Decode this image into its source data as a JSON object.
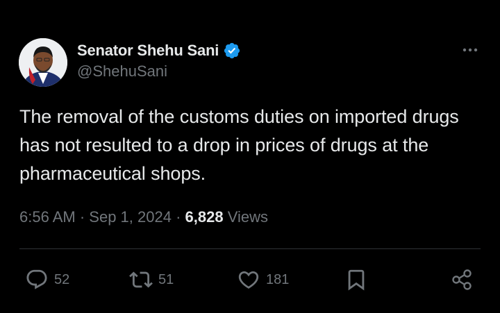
{
  "author": {
    "display_name": "Senator Shehu Sani",
    "handle": "@ShehuSani",
    "verified_icon": "verified-badge-icon",
    "avatar_icon": "avatar"
  },
  "tweet": {
    "text": "The removal of the customs duties on imported drugs has not resulted to a drop in prices of drugs at the pharmaceutical shops."
  },
  "meta": {
    "time": "6:56 AM",
    "separator": "·",
    "date": "Sep 1, 2024",
    "views_count": "6,828",
    "views_label": "Views"
  },
  "actions": {
    "replies": "52",
    "retweets": "51",
    "likes": "181"
  },
  "colors": {
    "background": "#000000",
    "primary_text": "#e7e9ea",
    "secondary_text": "#71767b",
    "verified": "#1d9bf0",
    "divider": "#2f3336"
  }
}
